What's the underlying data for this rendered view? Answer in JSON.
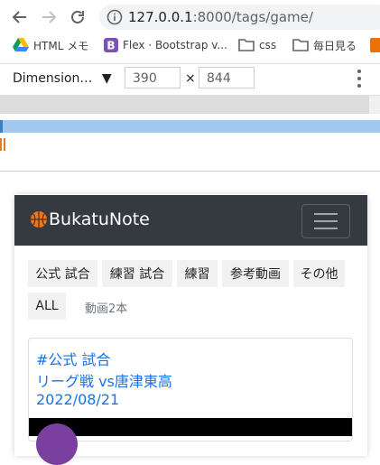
{
  "browser": {
    "url_host": "127.0.0.1",
    "url_path": ":8000/tags/game/",
    "bookmarks": [
      {
        "label": "HTML メモ",
        "icon": "drive-icon"
      },
      {
        "label": "Flex · Bootstrap v...",
        "icon": "bootstrap-icon"
      },
      {
        "label": "css",
        "icon": "folder-icon"
      },
      {
        "label": "毎日見る",
        "icon": "folder-icon"
      }
    ],
    "colors": {
      "bootstrap": "#7952b3",
      "link": "#1a73e8",
      "navbar": "#343a40"
    }
  },
  "devtools": {
    "dimension_label": "Dimension…",
    "width": "390",
    "height": "844",
    "times": "×"
  },
  "app": {
    "brand": "BukatuNote",
    "tags": [
      "公式 試合",
      "練習 試合",
      "練習",
      "参考動画",
      "その他",
      "ALL"
    ],
    "video_count": "動画2本",
    "post": {
      "tag": "#公式 試合",
      "title": "リーグ戦 vs唐津東高",
      "date": "2022/08/21"
    }
  }
}
